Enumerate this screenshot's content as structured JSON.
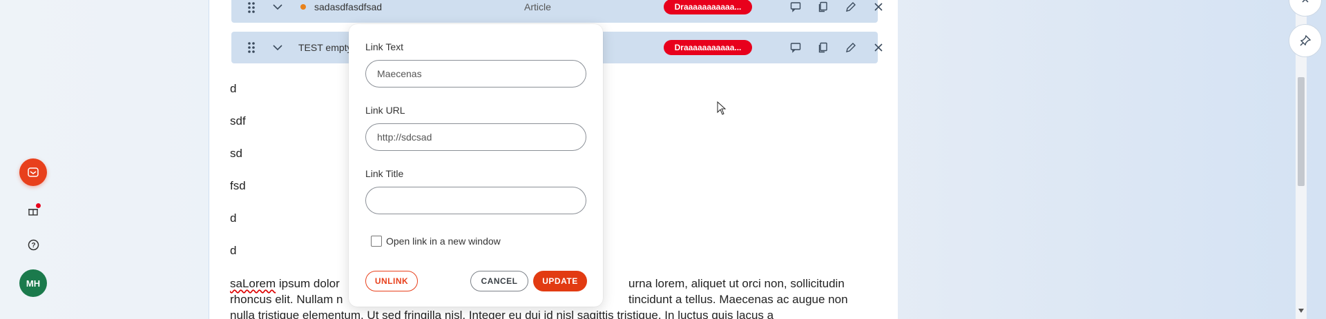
{
  "rail": {
    "avatar_initials": "MH",
    "accent_color": "#e8401c"
  },
  "blocks": [
    {
      "title": "sadasdfasdfsad",
      "type": "Article",
      "badge": "Draaaaaaaaaaa...",
      "status_color": "#e8821c"
    },
    {
      "title": "TEST empty",
      "type": "",
      "badge": "Draaaaaaaaaaa..."
    }
  ],
  "content": {
    "lines": [
      "d",
      "sdf",
      "sd",
      "fsd",
      "d",
      "d"
    ],
    "long_text_misspelled": "saLorem",
    "long_text_line1": " ipsum dolor",
    "long_text_line1_tail": "urna lorem, aliquet ut orci non, sollicitudin",
    "long_text_line2": "rhoncus elit. Nullam n",
    "long_text_line2_tail": "tincidunt a tellus. Maecenas ac augue non",
    "long_text_line3": "nulla tristique elementum. Ut sed fringilla nisl. Integer eu dui id nisl sagittis tristique. In luctus quis lacus a"
  },
  "dialog": {
    "link_text_label": "Link Text",
    "link_text_value": "Maecenas",
    "link_url_label": "Link URL",
    "link_url_value": "http://sdcsad",
    "link_title_label": "Link Title",
    "link_title_value": "",
    "new_window_label": "Open link in a new window",
    "new_window_checked": false,
    "unlink_label": "UNLINK",
    "cancel_label": "CANCEL",
    "update_label": "UPDATE"
  }
}
